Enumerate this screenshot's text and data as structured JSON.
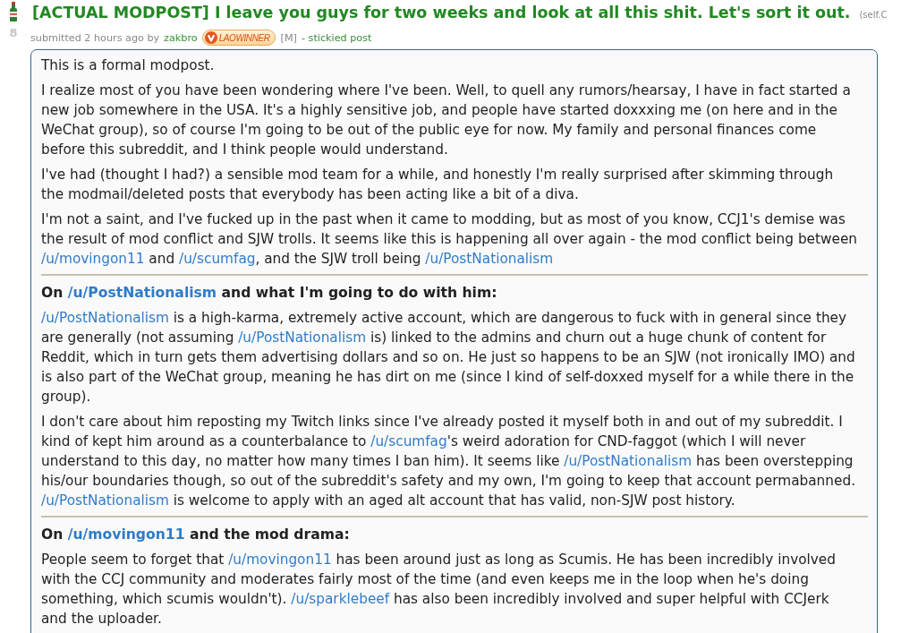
{
  "post": {
    "score": "8",
    "title": "[ACTUAL MODPOST] I leave you guys for two weeks and look at all this shit. Let's sort it out.",
    "domain": "(self.C",
    "tagline": {
      "submitted": "submitted 2 hours ago by",
      "author": "zakbro",
      "flair": "LAOWINNER",
      "distinguished": "[M]",
      "status": "- stickied post"
    },
    "body": [
      {
        "kind": "paragraph",
        "parts": [
          {
            "kind": "text",
            "text": "This is a formal modpost."
          }
        ]
      },
      {
        "kind": "paragraph",
        "parts": [
          {
            "kind": "text",
            "text": "I realize most of you have been wondering where I've been. Well, to quell any rumors/hearsay, I have in fact started a new job somewhere in the USA. It's a highly sensitive job, and people have started doxxxing me (on here and in the WeChat group), so of course I'm going to be out of the public eye for now. My family and personal finances come before this subreddit, and I think people would understand."
          }
        ]
      },
      {
        "kind": "paragraph",
        "parts": [
          {
            "kind": "text",
            "text": "I've had (thought I had?) a sensible mod team for a while, and honestly I'm really surprised after skimming through the modmail/deleted posts that everybody has been acting like a bit of a diva."
          }
        ]
      },
      {
        "kind": "paragraph",
        "parts": [
          {
            "kind": "text",
            "text": "I'm not a saint, and I've fucked up in the past when it came to modding, but as most of you know, CCJ1's demise was the result of mod conflict and SJW trolls. It seems like this is happening all over again - the mod conflict being between "
          },
          {
            "kind": "link",
            "text": "/u/movingon11"
          },
          {
            "kind": "text",
            "text": " and "
          },
          {
            "kind": "link",
            "text": "/u/scumfag"
          },
          {
            "kind": "text",
            "text": ", and the SJW troll being "
          },
          {
            "kind": "link",
            "text": "/u/PostNationalism"
          }
        ]
      },
      {
        "kind": "rule"
      },
      {
        "kind": "heading",
        "parts": [
          {
            "kind": "text",
            "text": "On "
          },
          {
            "kind": "link",
            "text": "/u/PostNationalism"
          },
          {
            "kind": "text",
            "text": " and what I'm going to do with him:"
          }
        ]
      },
      {
        "kind": "paragraph",
        "parts": [
          {
            "kind": "link",
            "text": "/u/PostNationalism"
          },
          {
            "kind": "text",
            "text": " is a high-karma, extremely active account, which are dangerous to fuck with in general since they are generally (not assuming "
          },
          {
            "kind": "link",
            "text": "/u/PostNationalism"
          },
          {
            "kind": "text",
            "text": " is) linked to the admins and churn out a huge chunk of content for Reddit, which in turn gets them advertising dollars and so on. He just so happens to be an SJW (not ironically IMO) and is also part of the WeChat group, meaning he has dirt on me (since I kind of self-doxxed myself for a while there in the group)."
          }
        ]
      },
      {
        "kind": "paragraph",
        "parts": [
          {
            "kind": "text",
            "text": "I don't care about him reposting my Twitch links since I've already posted it myself both in and out of my subreddit. I kind of kept him around as a counterbalance to "
          },
          {
            "kind": "link",
            "text": "/u/scumfag"
          },
          {
            "kind": "text",
            "text": "'s weird adoration for CND-faggot (which I will never understand to this day, no matter how many times I ban him). It seems like "
          },
          {
            "kind": "link",
            "text": "/u/PostNationalism"
          },
          {
            "kind": "text",
            "text": " has been overstepping his/our boundaries though, so out of the subreddit's safety and my own, I'm going to keep that account permabanned. "
          },
          {
            "kind": "link",
            "text": "/u/PostNationalism"
          },
          {
            "kind": "text",
            "text": " is welcome to apply with an aged alt account that has valid, non-SJW post history."
          }
        ]
      },
      {
        "kind": "rule"
      },
      {
        "kind": "heading",
        "parts": [
          {
            "kind": "text",
            "text": "On "
          },
          {
            "kind": "link",
            "text": "/u/movingon11"
          },
          {
            "kind": "text",
            "text": " and the mod drama:"
          }
        ]
      },
      {
        "kind": "paragraph",
        "parts": [
          {
            "kind": "text",
            "text": "People seem to forget that "
          },
          {
            "kind": "link",
            "text": "/u/movingon11"
          },
          {
            "kind": "text",
            "text": " has been around just as long as Scumis. He has been incredibly involved with the CCJ community and moderates fairly most of the time (and even keeps me in the loop when he's doing something, which scumis wouldn't). "
          },
          {
            "kind": "link",
            "text": "/u/sparklebeef"
          },
          {
            "kind": "text",
            "text": " has also been incredibly involved and super helpful with CCJerk and the uploader."
          }
        ]
      }
    ]
  }
}
